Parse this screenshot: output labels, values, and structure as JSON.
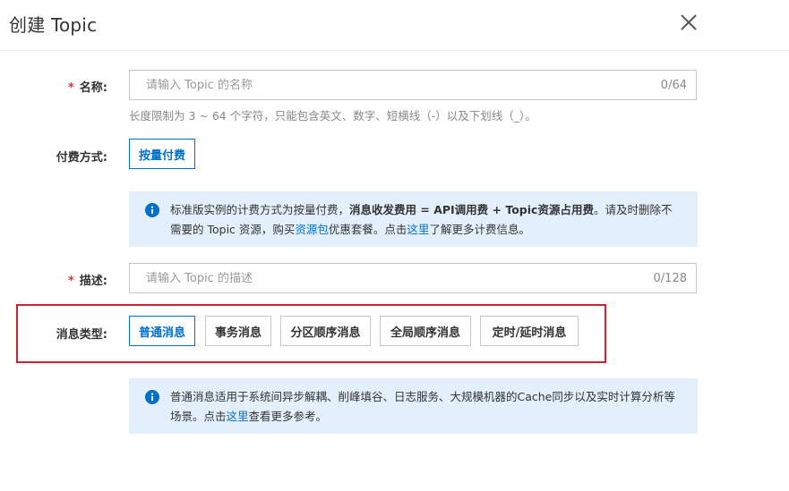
{
  "dialog": {
    "title": "创建 Topic"
  },
  "name_field": {
    "required_mark": "*",
    "label": "名称:",
    "placeholder": "请输入 Topic 的名称",
    "value": "",
    "counter": "0/64",
    "help": "长度限制为 3 ~ 64 个字符，只能包含英文、数字、短横线（-）以及下划线（_）。"
  },
  "billing": {
    "label": "付费方式:",
    "options": [
      "按量付费"
    ],
    "selected": "按量付费",
    "info": {
      "icon": "info-icon",
      "part1": "标准版实例的计费方式为按量付费，",
      "bold": "消息收发费用 = API调用费 + Topic资源占用费",
      "part2": "。请及时删除不需要的 Topic 资源，购买",
      "link1": "资源包",
      "part3": "优惠套餐。点击",
      "link2": "这里",
      "part4": "了解更多计费信息。"
    }
  },
  "description_field": {
    "required_mark": "*",
    "label": "描述:",
    "placeholder": "请输入 Topic 的描述",
    "value": "",
    "counter": "0/128"
  },
  "message_type": {
    "label": "消息类型:",
    "options": [
      "普通消息",
      "事务消息",
      "分区顺序消息",
      "全局顺序消息",
      "定时/延时消息"
    ],
    "selected": "普通消息",
    "info": {
      "icon": "info-icon",
      "part1": "普通消息适用于系统间异步解耦、削峰填谷、日志服务、大规模机器的Cache同步以及实时计算分析等场景。点击",
      "link": "这里",
      "part2": "查看更多参考。"
    }
  },
  "colors": {
    "accent": "#0070cc",
    "required": "#e0352b",
    "info_bg": "#e3f0fc",
    "highlight": "#c9232f"
  }
}
